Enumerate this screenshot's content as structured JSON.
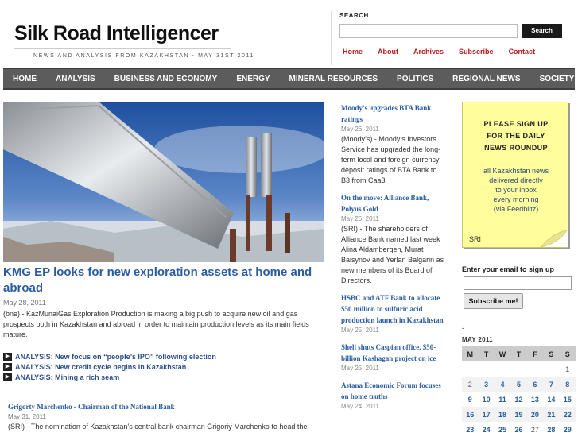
{
  "header": {
    "site_title": "Silk Road Intelligencer",
    "tagline": "NEWS AND ANALYSIS FROM KAZAKHSTAN - MAY 31ST 2011"
  },
  "search": {
    "label": "SEARCH",
    "value": "",
    "button_label": "Search"
  },
  "top_links": [
    "Home",
    "About",
    "Archives",
    "Subscribe",
    "Contact"
  ],
  "nav": [
    "HOME",
    "ANALYSIS",
    "BUSINESS AND ECONOMY",
    "ENERGY",
    "MINERAL RESOURCES",
    "POLITICS",
    "REGIONAL NEWS",
    "SOCIETY"
  ],
  "feature": {
    "image": "pipeline-photo",
    "title": "KMG EP looks for new exploration assets at home and abroad",
    "date": "May 28, 2011",
    "excerpt": "(bne) - KazMunaiGas Exploration Production is making a big push to acquire new oil and gas prospects both in Kazakhstan and abroad in order to maintain production levels as its main fields mature."
  },
  "analysis_links": [
    "ANALYSIS: New focus on “people’s IPO” following election",
    "ANALYSIS: New credit cycle begins in Kazakhstan",
    "ANALYSIS: Mining a rich seam"
  ],
  "story2": {
    "title": "Grigorty Marchenko - Chairman of the National Bank",
    "date": "May 31, 2011",
    "excerpt": "(SRI) - The nomination of Kazakhstan’s central bank chairman Grigoriy Marchenko to head the"
  },
  "mid_items": [
    {
      "title": "Moody’s upgrades BTA Bank ratings",
      "date": "May 26, 2011",
      "excerpt": "(Moody’s) - Moody’s Investors Service has upgraded the long-term local and foreign currency deposit ratings of BTA Bank to B3 from Caa3."
    },
    {
      "title": "On the move: Alliance Bank, Polyus Gold",
      "date": "May 26, 2011",
      "excerpt": "(SRI) - The shareholders of Alliance Bank named last week Alina Aldambergen, Murat Baisynov and Yerlan Balgarin as new members of its Board of Directors."
    },
    {
      "title": "HSBC and ATF Bank to allocate $50 million to sulfuric acid production launch in Kazakhstan",
      "date": "May 25, 2011",
      "excerpt": ""
    },
    {
      "title": "Shell shuts Caspian office, $50-billion Kashagan project on ice",
      "date": "May 25, 2011",
      "excerpt": ""
    },
    {
      "title": "Astana Economic Forum focuses on home truths",
      "date": "May 24, 2011",
      "excerpt": ""
    }
  ],
  "promo": {
    "head": [
      "PLEASE SIGN UP",
      "FOR THE DAILY",
      "NEWS ROUNDUP"
    ],
    "body": [
      "all Kazakhstan news",
      "delivered directly",
      "to your inbox",
      "every morning",
      "(via Feedblitz)"
    ],
    "sign": "SRI"
  },
  "email_signup": {
    "label": "Enter your email to sign up",
    "value": "",
    "button_label": "Subscribe me!"
  },
  "calendar": {
    "dash": "-",
    "month": "MAY 2011",
    "weekdays": [
      "M",
      "T",
      "W",
      "T",
      "F",
      "S",
      "S"
    ],
    "weeks": [
      [
        "",
        "",
        "",
        "",
        "",
        "",
        "1"
      ],
      [
        "2",
        "3",
        "4",
        "5",
        "6",
        "7",
        "8"
      ],
      [
        "9",
        "10",
        "11",
        "12",
        "13",
        "14",
        "15"
      ],
      [
        "16",
        "17",
        "18",
        "19",
        "20",
        "21",
        "22"
      ],
      [
        "23",
        "24",
        "25",
        "26",
        "27",
        "28",
        "29"
      ]
    ],
    "linked_days": [
      "3",
      "4",
      "5",
      "6",
      "7",
      "8",
      "9",
      "10",
      "11",
      "12",
      "13",
      "14",
      "15",
      "16",
      "17",
      "18",
      "19",
      "20",
      "21",
      "22",
      "23",
      "24",
      "25",
      "26",
      "28",
      "29"
    ]
  },
  "colors": {
    "nav_bg": "#5c5c5c",
    "link_blue": "#2a5da0",
    "top_link_red": "#b51c1c",
    "promo_yellow": "#fffd9c"
  }
}
